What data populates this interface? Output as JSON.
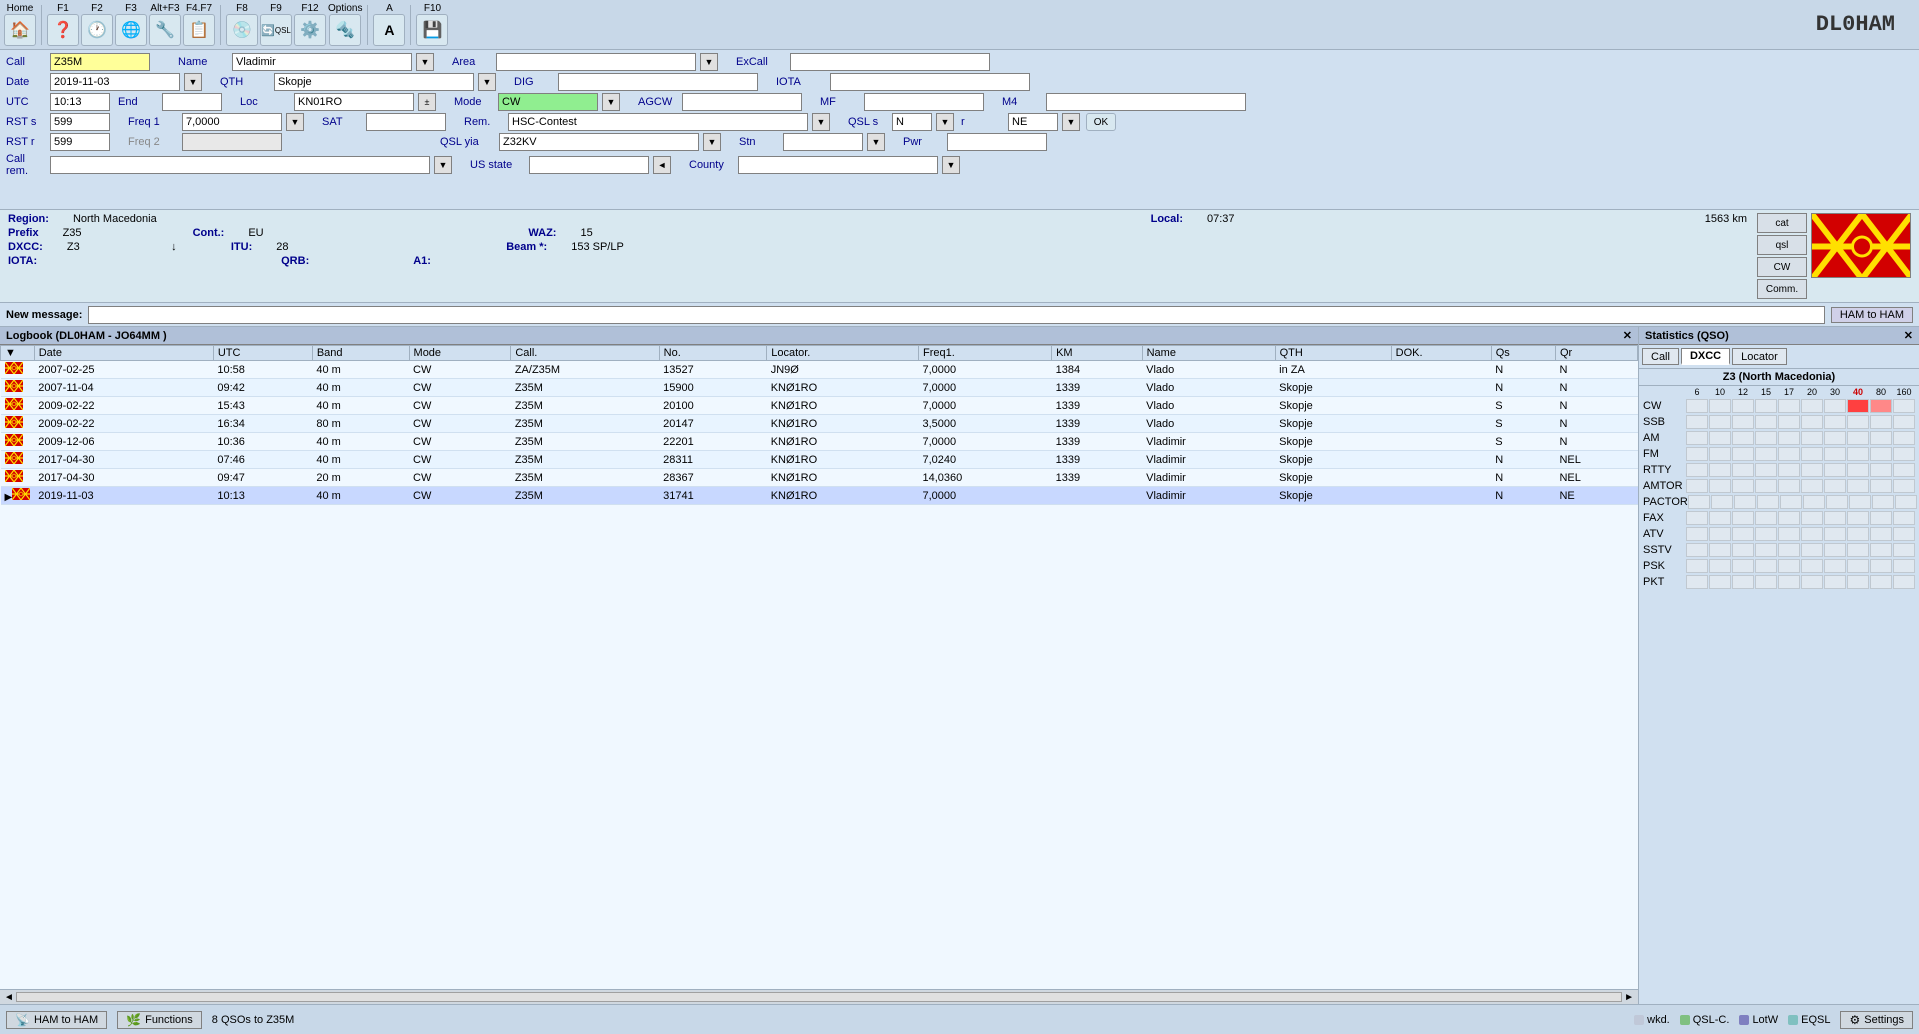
{
  "app": {
    "callsign": "DL0HAM",
    "title": "DL0HAM"
  },
  "menu": {
    "items": [
      "Home",
      "F1",
      "F2",
      "F3",
      "Alt+F3",
      "F4.F7",
      "F8",
      "F9",
      "F12",
      "Options",
      "A",
      "F10"
    ]
  },
  "entry": {
    "call_label": "Call",
    "call_value": "Z35M",
    "date_label": "Date",
    "date_value": "2019-11-03",
    "utc_label": "UTC",
    "utc_value": "10:13",
    "end_label": "End",
    "end_value": "",
    "rsts_label": "RST s",
    "rsts_value": "599",
    "rstr_label": "RST r",
    "rstr_value": "599",
    "callrem_label": "Call rem.",
    "callrem_value": "",
    "name_label": "Name",
    "name_value": "Vladimir",
    "qth_label": "QTH",
    "qth_value": "Skopje",
    "loc_label": "Loc",
    "loc_value": "KN01RO",
    "freq1_label": "Freq 1",
    "freq1_value": "7,0000",
    "freq2_label": "Freq 2",
    "freq2_value": "",
    "mode_label": "Mode",
    "mode_value": "CW",
    "sat_label": "SAT",
    "sat_value": "",
    "rem_label": "Rem.",
    "rem_value": "HSC-Contest",
    "area_label": "Area",
    "area_value": "",
    "dig_label": "DIG",
    "dig_value": "",
    "agcw_label": "AGCW",
    "agcw_value": "",
    "mf_label": "MF",
    "mf_value": "",
    "excall_label": "ExCall",
    "excall_value": "",
    "iota_label": "IOTA",
    "iota_value": "",
    "m4_label": "M4",
    "m4_value": "",
    "qsl_s_label": "QSL s",
    "qsl_s_value": "N",
    "qsl_r_label": "r",
    "qsl_r_value": "NE",
    "stn_label": "Stn",
    "stn_value": "",
    "pwr_label": "Pwr",
    "pwr_value": "",
    "qsl_via_label": "QSL yia",
    "qsl_via_value": "Z32KV",
    "us_state_label": "US state",
    "us_state_value": "",
    "county_label": "County",
    "county_value": "",
    "ok_label": "OK"
  },
  "info": {
    "region_label": "Region:",
    "region_value": "North Macedonia",
    "prefix_label": "Prefix",
    "prefix_value": "Z35",
    "cont_label": "Cont.:",
    "cont_value": "EU",
    "local_label": "Local:",
    "local_value": "07:37",
    "waz_label": "WAZ:",
    "waz_value": "15",
    "dxcc_label": "DXCC:",
    "dxcc_value": "Z3",
    "itu_label": "ITU:",
    "itu_value": "28",
    "beam_label": "Beam *:",
    "beam_value": "153 SP/LP",
    "iota_label": "IOTA:",
    "iota_value": "",
    "qrb_label": "QRB:",
    "qrb_value": "",
    "a1_label": "A1:",
    "a1_value": "",
    "km_value": "1563 km"
  },
  "message": {
    "label": "New message:",
    "value": "",
    "ham_to_ham": "HAM to HAM"
  },
  "logbook": {
    "title": "Logbook (DL0HAM - JO64MM )",
    "columns": [
      "",
      "Date",
      "UTC",
      "Band",
      "Mode",
      "Call.",
      "No.",
      "Locator.",
      "Freq1.",
      "KM",
      "Name",
      "QTH",
      "DOK.",
      "Qs",
      "Qr"
    ],
    "rows": [
      {
        "flag": "mk",
        "date": "2007-02-25",
        "utc": "10:58",
        "band": "40 m",
        "mode": "CW",
        "call": "ZA/Z35M",
        "no": "13527",
        "locator": "JN9Ø",
        "freq1": "7,0000",
        "km": "1384",
        "name": "Vlado",
        "qth": "in ZA",
        "dok": "",
        "qs": "N",
        "qr": "N"
      },
      {
        "flag": "mk",
        "date": "2007-11-04",
        "utc": "09:42",
        "band": "40 m",
        "mode": "CW",
        "call": "Z35M",
        "no": "15900",
        "locator": "KNØ1RO",
        "freq1": "7,0000",
        "km": "1339",
        "name": "Vlado",
        "qth": "Skopje",
        "dok": "",
        "qs": "N",
        "qr": "N"
      },
      {
        "flag": "mk",
        "date": "2009-02-22",
        "utc": "15:43",
        "band": "40 m",
        "mode": "CW",
        "call": "Z35M",
        "no": "20100",
        "locator": "KNØ1RO",
        "freq1": "7,0000",
        "km": "1339",
        "name": "Vlado",
        "qth": "Skopje",
        "dok": "",
        "qs": "S",
        "qr": "N"
      },
      {
        "flag": "mk",
        "date": "2009-02-22",
        "utc": "16:34",
        "band": "80 m",
        "mode": "CW",
        "call": "Z35M",
        "no": "20147",
        "locator": "KNØ1RO",
        "freq1": "3,5000",
        "km": "1339",
        "name": "Vlado",
        "qth": "Skopje",
        "dok": "",
        "qs": "S",
        "qr": "N"
      },
      {
        "flag": "mk",
        "date": "2009-12-06",
        "utc": "10:36",
        "band": "40 m",
        "mode": "CW",
        "call": "Z35M",
        "no": "22201",
        "locator": "KNØ1RO",
        "freq1": "7,0000",
        "km": "1339",
        "name": "Vladimir",
        "qth": "Skopje",
        "dok": "",
        "qs": "S",
        "qr": "N"
      },
      {
        "flag": "mk",
        "date": "2017-04-30",
        "utc": "07:46",
        "band": "40 m",
        "mode": "CW",
        "call": "Z35M",
        "no": "28311",
        "locator": "KNØ1RO",
        "freq1": "7,0240",
        "km": "1339",
        "name": "Vladimir",
        "qth": "Skopje",
        "dok": "",
        "qs": "N",
        "qr": "NEL"
      },
      {
        "flag": "mk",
        "date": "2017-04-30",
        "utc": "09:47",
        "band": "20 m",
        "mode": "CW",
        "call": "Z35M",
        "no": "28367",
        "locator": "KNØ1RO",
        "freq1": "14,0360",
        "km": "1339",
        "name": "Vladimir",
        "qth": "Skopje",
        "dok": "",
        "qs": "N",
        "qr": "NEL"
      },
      {
        "flag": "mk",
        "date": "2019-11-03",
        "utc": "10:13",
        "band": "40 m",
        "mode": "CW",
        "call": "Z35M",
        "no": "31741",
        "locator": "KNØ1RO",
        "freq1": "7,0000",
        "km": "",
        "name": "Vladimir",
        "qth": "Skopje",
        "dok": "",
        "qs": "N",
        "qr": "NE",
        "highlighted": true
      }
    ]
  },
  "stats": {
    "title": "Statistics (QSO)",
    "tabs": [
      "Call",
      "DXCC",
      "Locator"
    ],
    "active_tab": "DXCC",
    "country": "Z3 (North Macedonia)",
    "band_numbers": [
      "6",
      "10",
      "12",
      "15",
      "17",
      "20",
      "30",
      "40",
      "80",
      "160"
    ],
    "modes": [
      "CW",
      "SSB",
      "AM",
      "FM",
      "RTTY",
      "AMTOR",
      "PACTOR",
      "FAX",
      "ATV",
      "SSTV",
      "PSK",
      "PKT"
    ]
  },
  "bottom": {
    "ham_to_ham": "HAM to HAM",
    "functions": "Functions",
    "status": "8 QSOs to Z35M",
    "legend": {
      "wkd": "wkd.",
      "qsl_c": "QSL-C.",
      "lotw": "LotW",
      "eqsl": "EQSL",
      "settings": "Settings"
    }
  },
  "side_buttons": {
    "cat": "cat",
    "qsl": "qsl",
    "cw": "CW",
    "comm": "Comm."
  }
}
